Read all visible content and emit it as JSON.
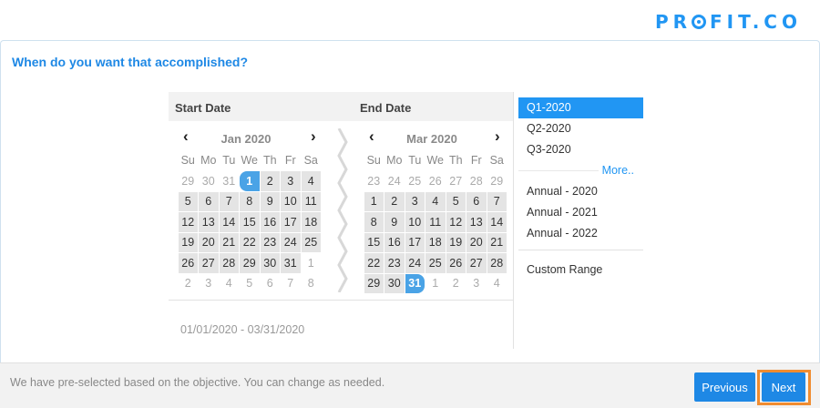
{
  "brand": {
    "text_before": "PR",
    "text_after": "FIT.CO",
    "color": "#2196f3"
  },
  "question": "When do you want that accomplished?",
  "picker": {
    "start_label": "Start Date",
    "end_label": "End Date",
    "start_month": "Jan 2020",
    "end_month": "Mar 2020",
    "weekdays": [
      "Su",
      "Mo",
      "Tu",
      "We",
      "Th",
      "Fr",
      "Sa"
    ],
    "start_days": [
      {
        "d": "29",
        "s": "out"
      },
      {
        "d": "30",
        "s": "out"
      },
      {
        "d": "31",
        "s": "out"
      },
      {
        "d": "1",
        "s": "sel start"
      },
      {
        "d": "2",
        "s": "in"
      },
      {
        "d": "3",
        "s": "in"
      },
      {
        "d": "4",
        "s": "in"
      },
      {
        "d": "5",
        "s": "in"
      },
      {
        "d": "6",
        "s": "in"
      },
      {
        "d": "7",
        "s": "in"
      },
      {
        "d": "8",
        "s": "in"
      },
      {
        "d": "9",
        "s": "in"
      },
      {
        "d": "10",
        "s": "in"
      },
      {
        "d": "11",
        "s": "in"
      },
      {
        "d": "12",
        "s": "in"
      },
      {
        "d": "13",
        "s": "in"
      },
      {
        "d": "14",
        "s": "in"
      },
      {
        "d": "15",
        "s": "in"
      },
      {
        "d": "16",
        "s": "in"
      },
      {
        "d": "17",
        "s": "in"
      },
      {
        "d": "18",
        "s": "in"
      },
      {
        "d": "19",
        "s": "in"
      },
      {
        "d": "20",
        "s": "in"
      },
      {
        "d": "21",
        "s": "in"
      },
      {
        "d": "22",
        "s": "in"
      },
      {
        "d": "23",
        "s": "in"
      },
      {
        "d": "24",
        "s": "in"
      },
      {
        "d": "25",
        "s": "in"
      },
      {
        "d": "26",
        "s": "in"
      },
      {
        "d": "27",
        "s": "in"
      },
      {
        "d": "28",
        "s": "in"
      },
      {
        "d": "29",
        "s": "in"
      },
      {
        "d": "30",
        "s": "in"
      },
      {
        "d": "31",
        "s": "in"
      },
      {
        "d": "1",
        "s": "out"
      },
      {
        "d": "2",
        "s": "out"
      },
      {
        "d": "3",
        "s": "out"
      },
      {
        "d": "4",
        "s": "out"
      },
      {
        "d": "5",
        "s": "out"
      },
      {
        "d": "6",
        "s": "out"
      },
      {
        "d": "7",
        "s": "out"
      },
      {
        "d": "8",
        "s": "out"
      }
    ],
    "end_days": [
      {
        "d": "23",
        "s": "out"
      },
      {
        "d": "24",
        "s": "out"
      },
      {
        "d": "25",
        "s": "out"
      },
      {
        "d": "26",
        "s": "out"
      },
      {
        "d": "27",
        "s": "out"
      },
      {
        "d": "28",
        "s": "out"
      },
      {
        "d": "29",
        "s": "out"
      },
      {
        "d": "1",
        "s": "in"
      },
      {
        "d": "2",
        "s": "in"
      },
      {
        "d": "3",
        "s": "in"
      },
      {
        "d": "4",
        "s": "in"
      },
      {
        "d": "5",
        "s": "in"
      },
      {
        "d": "6",
        "s": "in"
      },
      {
        "d": "7",
        "s": "in"
      },
      {
        "d": "8",
        "s": "in"
      },
      {
        "d": "9",
        "s": "in"
      },
      {
        "d": "10",
        "s": "in"
      },
      {
        "d": "11",
        "s": "in"
      },
      {
        "d": "12",
        "s": "in"
      },
      {
        "d": "13",
        "s": "in"
      },
      {
        "d": "14",
        "s": "in"
      },
      {
        "d": "15",
        "s": "in"
      },
      {
        "d": "16",
        "s": "in"
      },
      {
        "d": "17",
        "s": "in"
      },
      {
        "d": "18",
        "s": "in"
      },
      {
        "d": "19",
        "s": "in"
      },
      {
        "d": "20",
        "s": "in"
      },
      {
        "d": "21",
        "s": "in"
      },
      {
        "d": "22",
        "s": "in"
      },
      {
        "d": "23",
        "s": "in"
      },
      {
        "d": "24",
        "s": "in"
      },
      {
        "d": "25",
        "s": "in"
      },
      {
        "d": "26",
        "s": "in"
      },
      {
        "d": "27",
        "s": "in"
      },
      {
        "d": "28",
        "s": "in"
      },
      {
        "d": "29",
        "s": "in"
      },
      {
        "d": "30",
        "s": "in"
      },
      {
        "d": "31",
        "s": "sel end"
      },
      {
        "d": "1",
        "s": "out"
      },
      {
        "d": "2",
        "s": "out"
      },
      {
        "d": "3",
        "s": "out"
      },
      {
        "d": "4",
        "s": "out"
      }
    ],
    "range_text": "01/01/2020 - 03/31/2020"
  },
  "options": {
    "quarters": [
      "Q1-2020",
      "Q2-2020",
      "Q3-2020"
    ],
    "active": "Q1-2020",
    "more_label": "More..",
    "annual": [
      "Annual - 2020",
      "Annual - 2021",
      "Annual - 2022"
    ],
    "custom_label": "Custom Range"
  },
  "footer": {
    "note": "We have pre-selected based on the objective. You can change as needed.",
    "previous_label": "Previous",
    "next_label": "Next"
  },
  "colors": {
    "accent": "#2196f3",
    "selected_day": "#4aa3e6",
    "focus_ring": "#f08c30"
  }
}
